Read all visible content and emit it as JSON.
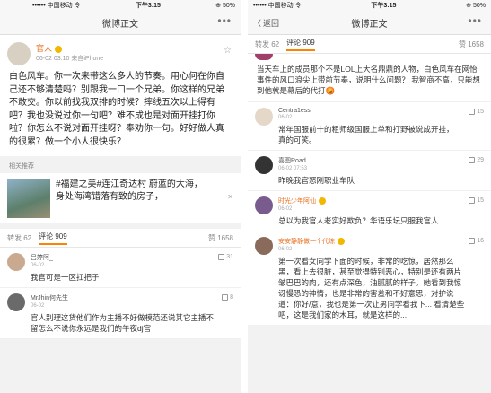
{
  "left": {
    "status": {
      "carrier": "•••••• 中国移动 令",
      "time": "下午3:15",
      "battery": "⊕ 50%"
    },
    "nav": {
      "title": "微博正文",
      "more": "•••"
    },
    "post": {
      "author": "官人",
      "time": "06-02 03:10",
      "source": "来自iPhone",
      "text": "白色风车。你一次来带这么多人的节奏。用心何在你自己还不够清楚吗？别跟我一口一个兄弟。你这样的兄弟不敢交。你以前找我双排的时候？摔线五次以上得有吧？我也没说过你一句吧？难不成也是对面开挂打你啦？你怎么不说对面开挂呀？奉劝你一句。好好做人真的很累？做一个小人很快乐？"
    },
    "recommend": {
      "label": "相关推荐",
      "text": "#福建之美#连江奇达村 蔚蓝的大海，身处海湾错落有致的房子，",
      "close": "✕"
    },
    "tabs": {
      "repost": "转发 62",
      "comments": "评论 909",
      "likes": "赞 1658"
    },
    "comments": [
      {
        "name": "吕婷阿_",
        "time": "06-02",
        "text": "我官可是一区扛把子",
        "likes": "31"
      },
      {
        "name": "MrJhin何先生",
        "time": "06-02",
        "text": "官人别理这货他们作为主播不好做模范还说其它主播不留怎么不说你永远是我们的午夜dj官",
        "likes": "8"
      }
    ]
  },
  "right": {
    "status": {
      "carrier": "•••••• 中国移动 令",
      "time": "下午3:15",
      "battery": "⊕ 50%"
    },
    "nav": {
      "back": "返回",
      "title": "微博正文",
      "more": "•••"
    },
    "tabs": {
      "repost": "转发 62",
      "comments": "评论 909",
      "likes": "赞 1658"
    },
    "top_text": "当天车上的成员那个不是LOL上大名鼎鼎的人物，白色风车在网怡事件的风口浪尖上带前节奏，说明什么问题？ 我智商不高，只能想到他就是幕后的代打😡",
    "comments": [
      {
        "name": "Centra1ess",
        "time": "06-02",
        "text": "常年国服前十的粗师级国服上单和打野被说成开挂，真的可笑。",
        "likes": "15",
        "orange": false
      },
      {
        "name": "喜图Road",
        "time": "06-02 07:53",
        "text": "昨晚我官怒刚职业车队",
        "likes": "29",
        "orange": false
      },
      {
        "name": "时光少年阿仙",
        "time": "06-02",
        "text": "总以为我官人老实好欺负？华语乐坛只服我官人",
        "likes": "15",
        "orange": true
      },
      {
        "name": "安安静静做一个代练",
        "time": "06-02",
        "text": "第一次看女同学下面的时候，非常的吃惊，居然那么黑，看上去很脏，甚至觉得特别恶心，特别是还有两片皱巴巴的肉，还有点深色，油腻腻的样子。她看到我惊讶慢恐的神情，也是非常的害羞和不好意思，对护说道：你好/意，我也是第一次让男同学看我下... 看清楚些吧，这是我们家的木耳，就是这样的...",
        "likes": "16",
        "orange": true
      }
    ]
  },
  "colors": {
    "accent": "#ff8200",
    "username": "#e86f1c",
    "logo": "#e8452b"
  }
}
